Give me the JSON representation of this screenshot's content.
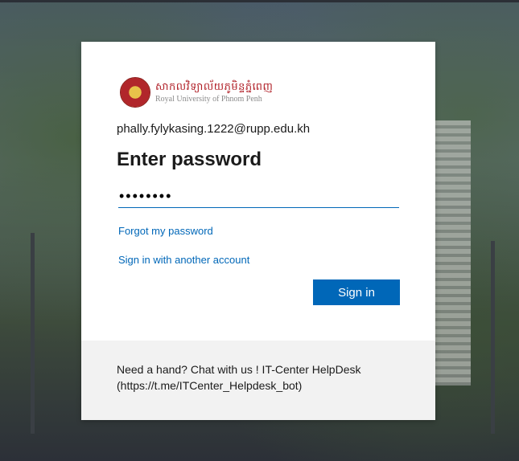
{
  "organization": {
    "name_khmer": "សាកលវិទ្យាល័យភូមិន្ទភ្នំពេញ",
    "name_english": "Royal University of Phnom Penh"
  },
  "account": {
    "email": "phally.fylykasing.1222@rupp.edu.kh"
  },
  "form": {
    "title": "Enter password",
    "password_value": "••••••••",
    "forgot_link": "Forgot my password",
    "another_account_link": "Sign in with another account",
    "signin_button": "Sign in"
  },
  "footer": {
    "help_text": "Need a hand? Chat with us ! IT-Center HelpDesk (https://t.me/ITCenter_Helpdesk_bot)"
  },
  "colors": {
    "accent": "#0067b8",
    "footer_bg": "#f2f2f2"
  }
}
